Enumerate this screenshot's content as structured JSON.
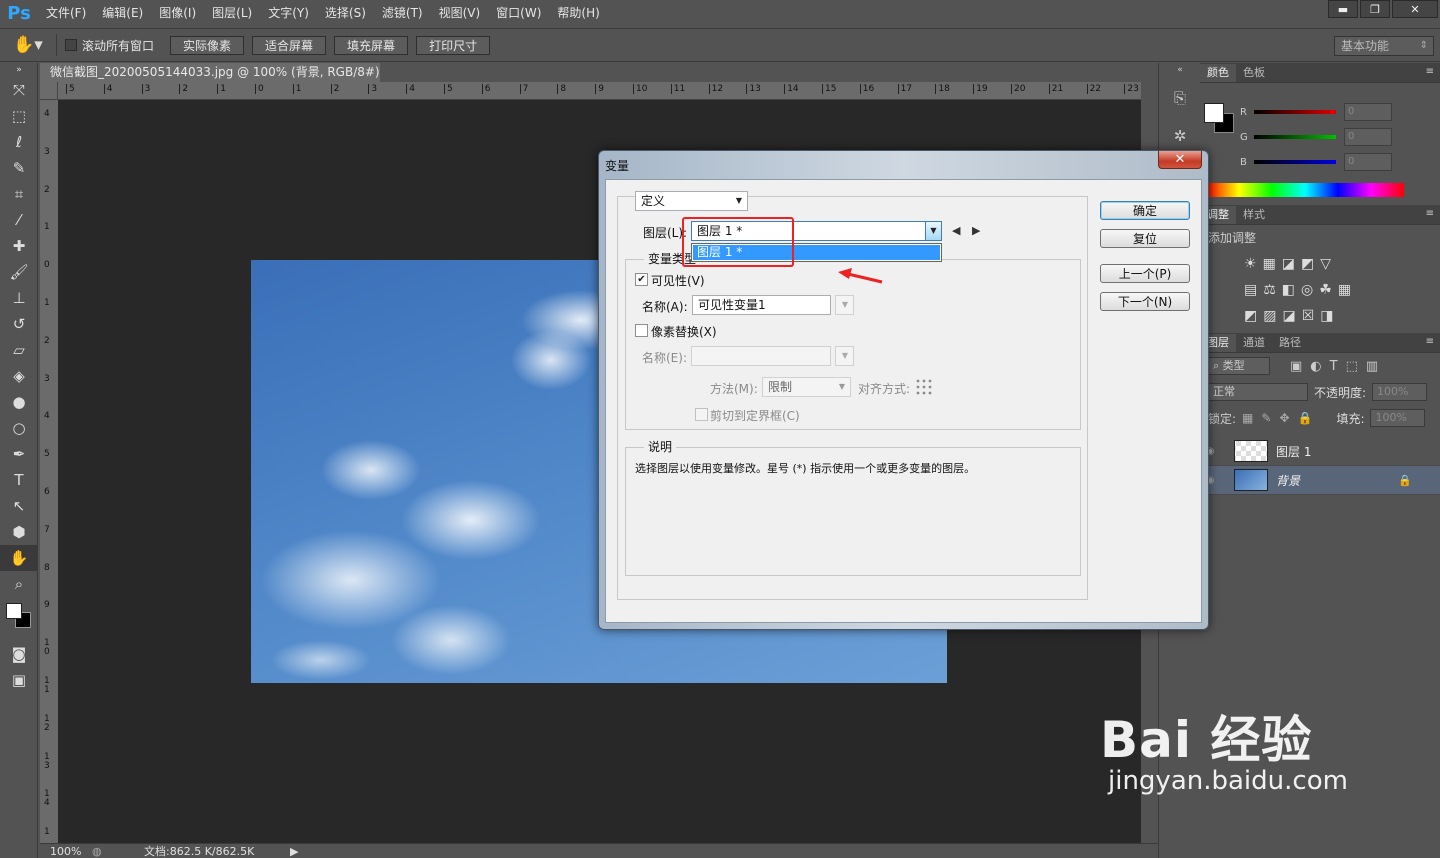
{
  "app": {
    "logo": "Ps"
  },
  "menu": [
    "文件(F)",
    "编辑(E)",
    "图像(I)",
    "图层(L)",
    "文字(Y)",
    "选择(S)",
    "滤镜(T)",
    "视图(V)",
    "窗口(W)",
    "帮助(H)"
  ],
  "window_controls": {
    "minimize": "▬",
    "restore": "❐",
    "close": "✕"
  },
  "options_bar": {
    "hand_icon": "hand-icon",
    "scroll_all_label": "滚动所有窗口",
    "buttons": [
      "实际像素",
      "适合屏幕",
      "填充屏幕",
      "打印尺寸"
    ],
    "workspace": "基本功能"
  },
  "document_tab": {
    "title": "微信截图_20200505144033.jpg @ 100% (背景, RGB/8#) *",
    "close": "×"
  },
  "ruler_top_ticks": [
    "5",
    "4",
    "3",
    "2",
    "1",
    "0",
    "1",
    "2",
    "3",
    "4",
    "5",
    "6",
    "7",
    "8",
    "9",
    "10",
    "11",
    "12",
    "13",
    "14",
    "15",
    "16",
    "17",
    "18",
    "19",
    "20",
    "21",
    "22",
    "23"
  ],
  "ruler_left_ticks": [
    "4",
    "3",
    "2",
    "1",
    "0",
    "1",
    "2",
    "3",
    "4",
    "5",
    "6",
    "7",
    "8",
    "9",
    "1 0",
    "1 1",
    "1 2",
    "1 3",
    "1 4",
    "1"
  ],
  "status": {
    "zoom": "100%",
    "doc": "文档:862.5 K/862.5K"
  },
  "color_panel": {
    "tabs": [
      "颜色",
      "色板"
    ],
    "channels": [
      {
        "label": "R",
        "value": "0",
        "color": "#e00000"
      },
      {
        "label": "G",
        "value": "0",
        "color": "#00c000"
      },
      {
        "label": "B",
        "value": "0",
        "color": "#0000e0"
      }
    ]
  },
  "adjust_panel": {
    "tabs": [
      "调整",
      "样式"
    ],
    "title": "添加调整"
  },
  "layers_panel": {
    "tabs": [
      "图层",
      "通道",
      "路径"
    ],
    "filter": "类型",
    "blend_mode": "正常",
    "opacity_label": "不透明度:",
    "opacity_value": "100%",
    "lock_label": "锁定:",
    "fill_label": "填充:",
    "fill_value": "100%",
    "layers": [
      {
        "name": "图层 1"
      },
      {
        "name": "背景"
      }
    ]
  },
  "dialog": {
    "title": "变量",
    "close": "✕",
    "define_value": "定义",
    "layer_label": "图层(L):",
    "layer_value": "图层 1 *",
    "dropdown_items": [
      "图层 1 *"
    ],
    "var_type_legend": "变量类型",
    "visibility_label": "可见性(V)",
    "name_label": "名称(A):",
    "name_value": "可见性变量1",
    "pixel_replace_label": "像素替换(X)",
    "name2_label": "名称(E):",
    "method_label": "方法(M):",
    "method_value": "限制",
    "align_label": "对齐方式:",
    "clip_label": "剪切到定界框(C)",
    "desc_legend": "说明",
    "desc_text": "选择图层以使用变量修改。星号 (*) 指示使用一个或更多变量的图层。",
    "buttons": {
      "ok": "确定",
      "reset": "复位",
      "prev": "上一个(P)",
      "next": "下一个(N)"
    }
  },
  "watermark": {
    "big": "Bai 经验",
    "small": "jingyan.baidu.com"
  }
}
